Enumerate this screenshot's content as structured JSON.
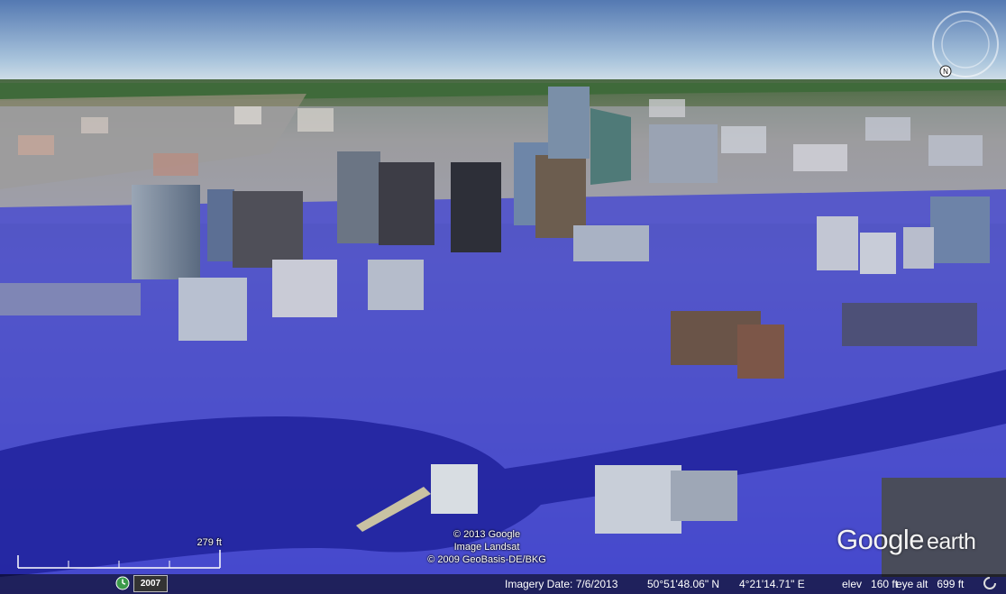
{
  "app": {
    "name": "Google Earth"
  },
  "attribution": {
    "lines": [
      "© 2013 Google",
      "Image Landsat",
      "© 2009 GeoBasis-DE/BKG"
    ]
  },
  "logo": {
    "word1": "Google",
    "word2": "earth"
  },
  "scale_bar": {
    "label": "279 ft"
  },
  "historical_imagery": {
    "year": "2007",
    "icon": "clock-icon"
  },
  "status": {
    "imagery_date": "Imagery Date: 7/6/2013",
    "latitude": "50°51'48.06\" N",
    "longitude": "4°21'14.71\" E",
    "elevation": "elev   160 ft",
    "eye_altitude": "eye alt   699 ft"
  },
  "navigation": {
    "compass_icon": "compass-ring-icon",
    "north_icon": "north-arrow-icon",
    "loading_icon": "loading-spinner-icon"
  },
  "colors": {
    "sky_top": "#5b83b8",
    "sky_horizon": "#cfe0ea",
    "water": "#2b2fb0",
    "flood_overlay": "#3b3de8"
  }
}
